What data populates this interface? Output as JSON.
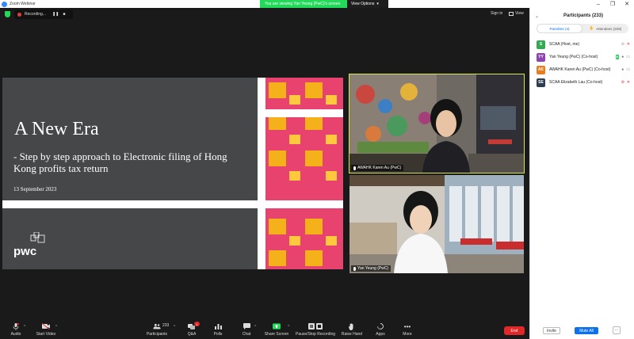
{
  "window": {
    "title": "Zoom Webinar",
    "controls": [
      "–",
      "❐",
      "✕"
    ]
  },
  "banner": {
    "message": "You are viewing Yan Yeung (PwC)'s screen",
    "view_options": "View Options"
  },
  "topbar": {
    "recording_label": "Recording...",
    "pause_symbol": "❚❚",
    "stop_symbol": "■",
    "sign_in": "Sign in",
    "view": "View"
  },
  "slide": {
    "title": "A New Era",
    "subtitle": "- Step by step approach to Electronic filing of Hong Kong profits tax return",
    "date": "13 September 2023",
    "logo_text": "pwc"
  },
  "videos": [
    {
      "name": "AWAHK Karen Au (PwC)"
    },
    {
      "name": "Yan Yeung (PwC)"
    }
  ],
  "toolbar": {
    "audio": "Audio",
    "start_video": "Start Video",
    "participants": "Participants",
    "participants_count": "233",
    "qa": "Q&A",
    "qa_badge": "1",
    "polls": "Polls",
    "chat": "Chat",
    "share_screen": "Share Screen",
    "pause_stop_recording": "Pause/Stop Recording",
    "raise_hand": "Raise Hand",
    "apps": "Apps",
    "more": "More",
    "end": "End"
  },
  "participants_panel": {
    "title": "Participants (233)",
    "tabs": [
      {
        "label": "Panelists (4)",
        "selected": true
      },
      {
        "label": "Attendees (229)",
        "selected": false
      }
    ],
    "panelists": [
      {
        "initials": "S",
        "name": "SCAA (Host, me)",
        "color": "#34a853"
      },
      {
        "initials": "YY",
        "name": "Yan Yeung (PwC) (Co-host)",
        "color": "#8e44ad"
      },
      {
        "initials": "AK",
        "name": "AWAHK Karen Au (PwC) (Co-host)",
        "color": "#e67e22"
      },
      {
        "initials": "SE",
        "name": "SCAA Elizabeth Lau (Co-host)",
        "color": "#2c3e50"
      }
    ],
    "invite": "Invite",
    "mute_all": "Mute All",
    "more": "···"
  },
  "colors": {
    "accent_blue": "#0e71eb",
    "banner_green": "#23d959",
    "end_red": "#e02828",
    "active_speaker": "#d6e84a",
    "slide_pink": "#e8436e",
    "slide_orange": "#f5b119",
    "slide_gray": "#464749"
  }
}
